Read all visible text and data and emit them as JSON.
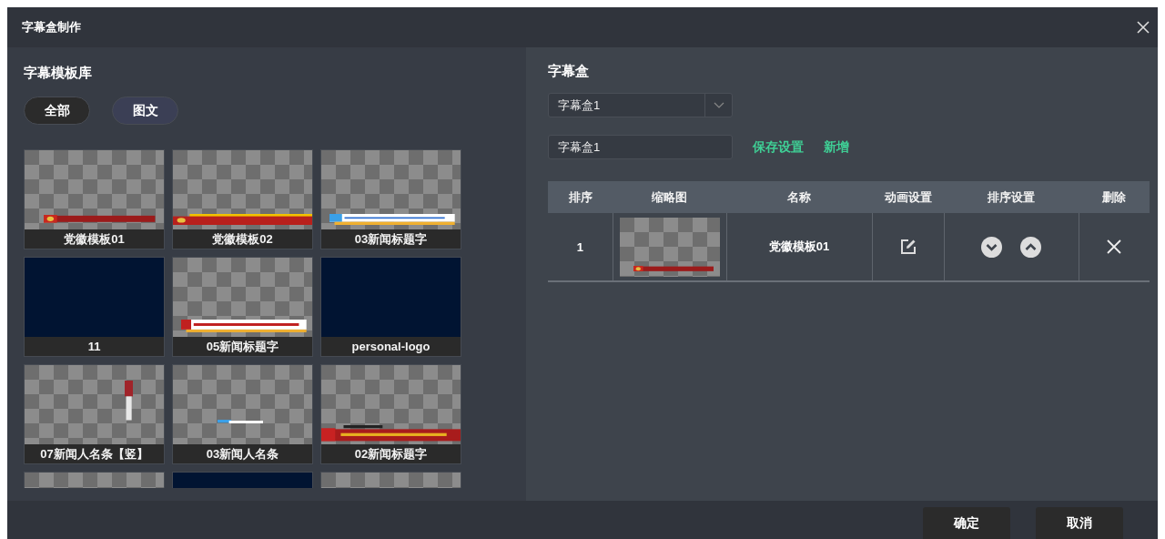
{
  "window": {
    "title": "字幕盒制作"
  },
  "library": {
    "title": "字幕模板库",
    "filters": [
      {
        "label": "全部",
        "selected": true
      },
      {
        "label": "图文",
        "selected": false
      }
    ],
    "templates": [
      {
        "label": "党徽模板01",
        "kind": "ribbon"
      },
      {
        "label": "党徽模板02",
        "kind": "flagbar"
      },
      {
        "label": "03新闻标题字",
        "kind": "bluebar"
      },
      {
        "label": "11",
        "kind": "dark"
      },
      {
        "label": "05新闻标题字",
        "kind": "whitebar"
      },
      {
        "label": "personal-logo",
        "kind": "dark"
      },
      {
        "label": "07新闻人名条【竖】",
        "kind": "vertical"
      },
      {
        "label": "03新闻人名条",
        "kind": "nametag"
      },
      {
        "label": "02新闻标题字",
        "kind": "widebar"
      },
      {
        "kind": "blank"
      },
      {
        "kind": "dark"
      },
      {
        "kind": "blank"
      }
    ]
  },
  "caption_box": {
    "title": "字幕盒",
    "dropdown": {
      "value": "字幕盒1"
    },
    "name_field": {
      "value": "字幕盒1"
    },
    "links": [
      "保存设置",
      "新增"
    ],
    "table": {
      "columns": [
        "排序",
        "缩略图",
        "名称",
        "动画设置",
        "排序设置",
        "删除"
      ],
      "rows": [
        {
          "order": "1",
          "thumbnail": {
            "kind": "ribbon"
          },
          "name": "党徽模板01"
        }
      ]
    }
  },
  "buttons": [
    "确定",
    "取消"
  ]
}
